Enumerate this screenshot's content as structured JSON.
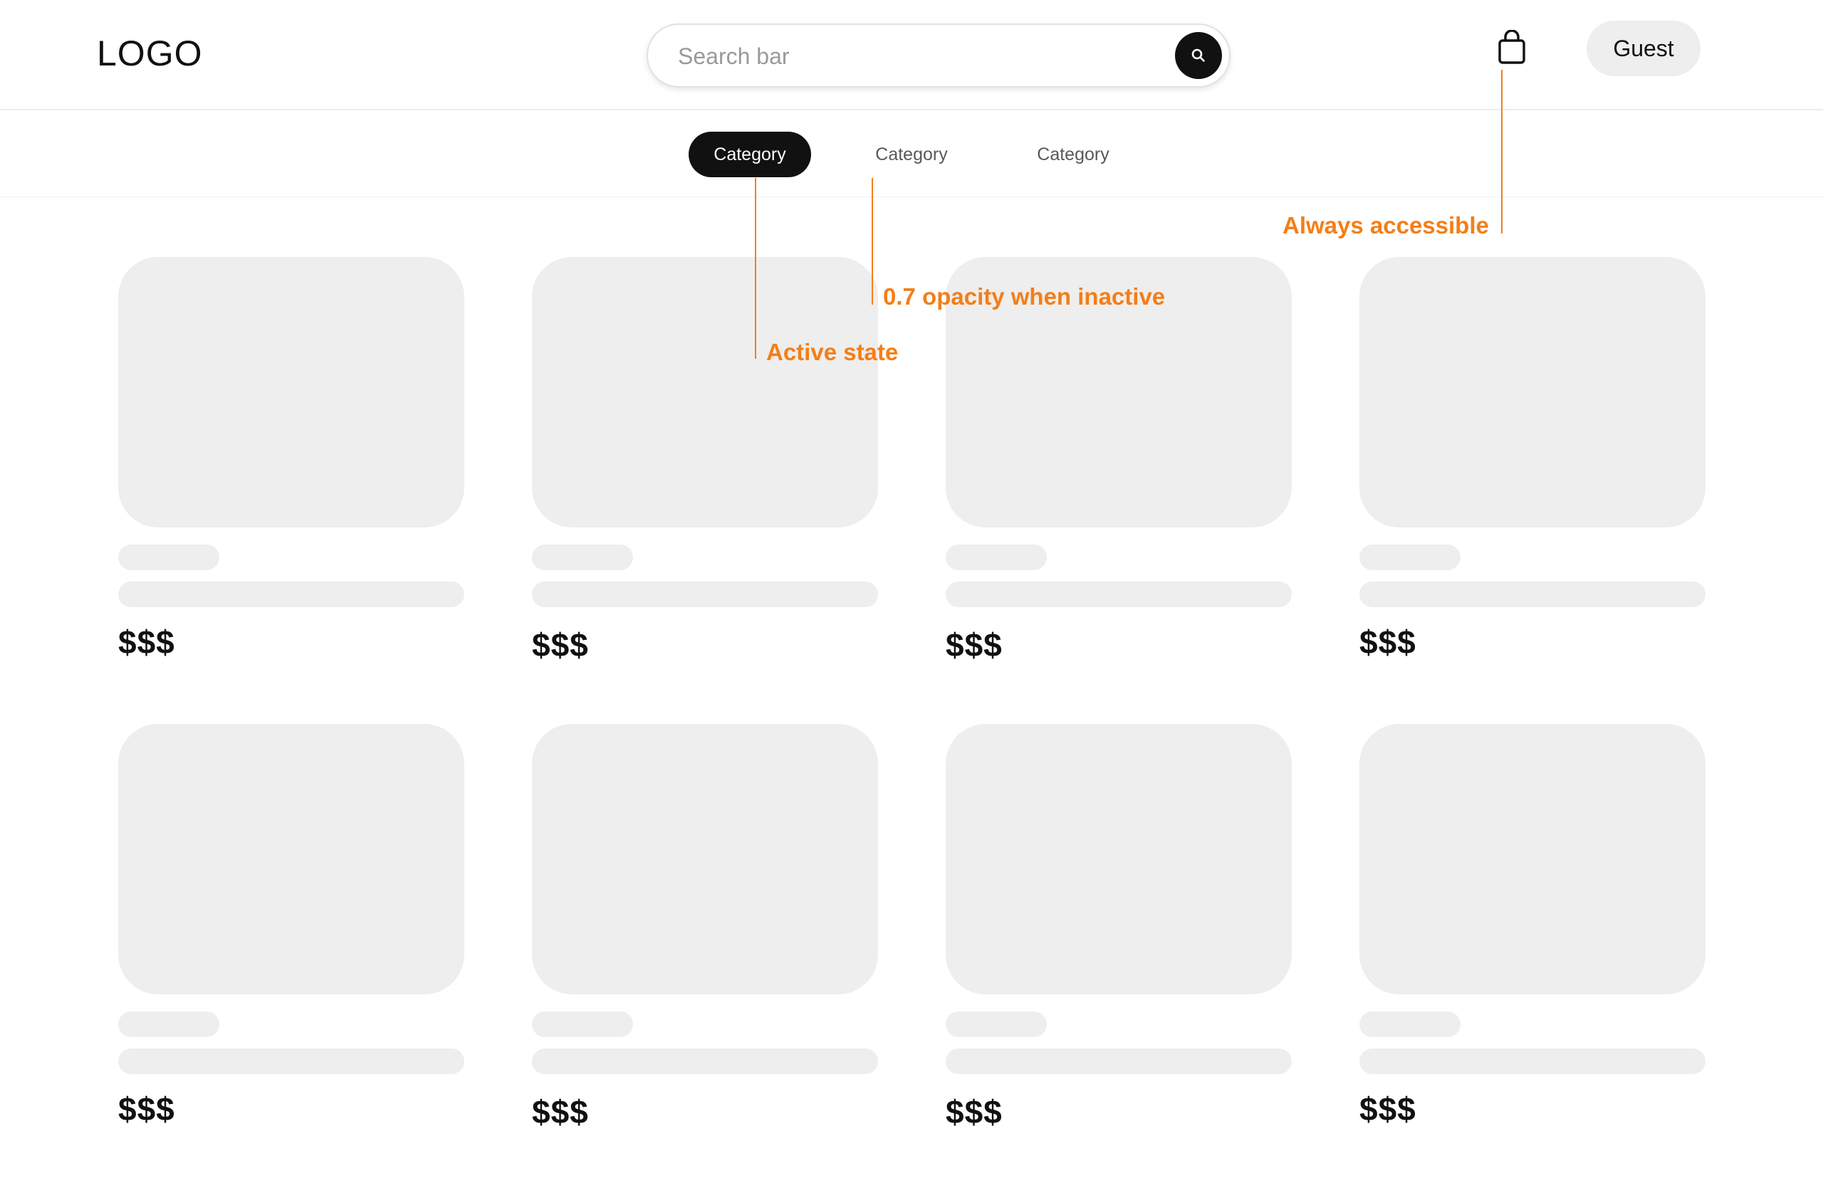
{
  "header": {
    "logo": "LOGO",
    "search_placeholder": "Search bar",
    "search_button_icon": "search-icon",
    "cart_icon": "shopping-bag-icon",
    "user_label": "Guest"
  },
  "categories": [
    {
      "label": "Category",
      "state": "active"
    },
    {
      "label": "Category",
      "state": "inactive"
    },
    {
      "label": "Category",
      "state": "inactive"
    }
  ],
  "products": [
    {
      "price": "$$$"
    },
    {
      "price": "$$$"
    },
    {
      "price": "$$$"
    },
    {
      "price": "$$$"
    },
    {
      "price": "$$$"
    },
    {
      "price": "$$$"
    },
    {
      "price": "$$$"
    },
    {
      "price": "$$$"
    }
  ],
  "annotations": {
    "active_state": "Active state",
    "inactive_opacity": "0.7 opacity when inactive",
    "always_accessible": "Always accessible"
  },
  "colors": {
    "annotation": "#f47e17",
    "active_pill": "#111111",
    "placeholder_fill": "#eeeeee"
  }
}
